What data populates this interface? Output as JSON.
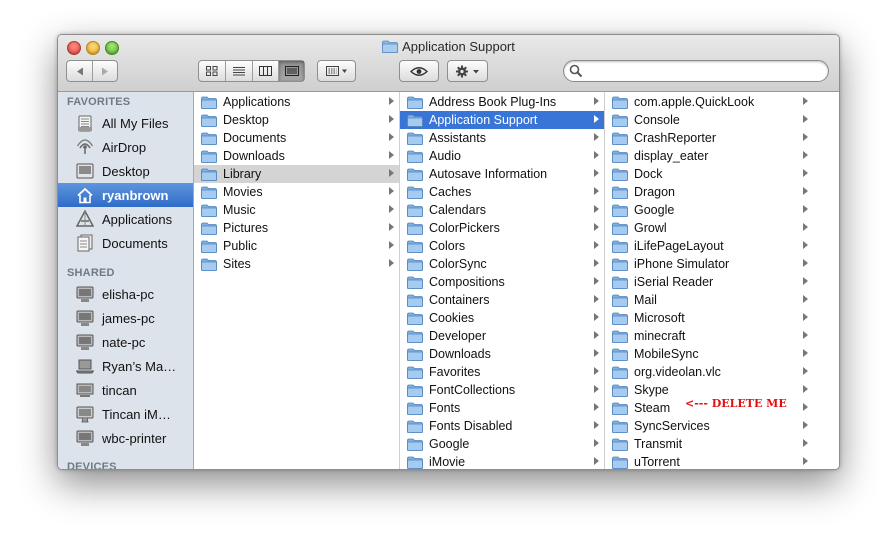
{
  "window": {
    "title": "Application Support"
  },
  "sidebar": {
    "favorites_header": "FAVORITES",
    "favorites": [
      {
        "label": "All My Files",
        "icon": "all-files-icon"
      },
      {
        "label": "AirDrop",
        "icon": "airdrop-icon"
      },
      {
        "label": "Desktop",
        "icon": "desktop-icon"
      },
      {
        "label": "ryanbrown",
        "icon": "home-icon",
        "selected": true
      },
      {
        "label": "Applications",
        "icon": "applications-icon"
      },
      {
        "label": "Documents",
        "icon": "documents-icon"
      }
    ],
    "shared_header": "SHARED",
    "shared": [
      {
        "label": "elisha-pc",
        "icon": "pc-icon"
      },
      {
        "label": "james-pc",
        "icon": "pc-icon"
      },
      {
        "label": "nate-pc",
        "icon": "pc-icon"
      },
      {
        "label": "Ryan’s Ma…",
        "icon": "laptop-icon"
      },
      {
        "label": "tincan",
        "icon": "server-icon"
      },
      {
        "label": "Tincan iM…",
        "icon": "imac-icon"
      },
      {
        "label": "wbc-printer",
        "icon": "pc-icon"
      }
    ],
    "devices_header": "DEVICES"
  },
  "columns": {
    "col1": [
      "Applications",
      "Desktop",
      "Documents",
      "Downloads",
      "Library",
      "Movies",
      "Music",
      "Pictures",
      "Public",
      "Sites"
    ],
    "col1_selected": 4,
    "col2": [
      "Address Book Plug-Ins",
      "Application Support",
      "Assistants",
      "Audio",
      "Autosave Information",
      "Caches",
      "Calendars",
      "ColorPickers",
      "Colors",
      "ColorSync",
      "Compositions",
      "Containers",
      "Cookies",
      "Developer",
      "Downloads",
      "Favorites",
      "FontCollections",
      "Fonts",
      "Fonts Disabled",
      "Google",
      "iMovie"
    ],
    "col2_selected": 1,
    "col3": [
      "com.apple.QuickLook",
      "Console",
      "CrashReporter",
      "display_eater",
      "Dock",
      "Dragon",
      "Google",
      "Growl",
      "iLifePageLayout",
      "iPhone Simulator",
      "iSerial Reader",
      "Mail",
      "Microsoft",
      "minecraft",
      "MobileSync",
      "org.videolan.vlc",
      "Skype",
      "Steam",
      "SyncServices",
      "Transmit",
      "uTorrent"
    ]
  },
  "annotation": {
    "text": "<--- DELETE ME",
    "color": "#e01010"
  },
  "colors": {
    "selection_blue": "#3875d7",
    "sidebar_bg": "#dde3ea",
    "folder_blue": "#8cb8e6"
  }
}
